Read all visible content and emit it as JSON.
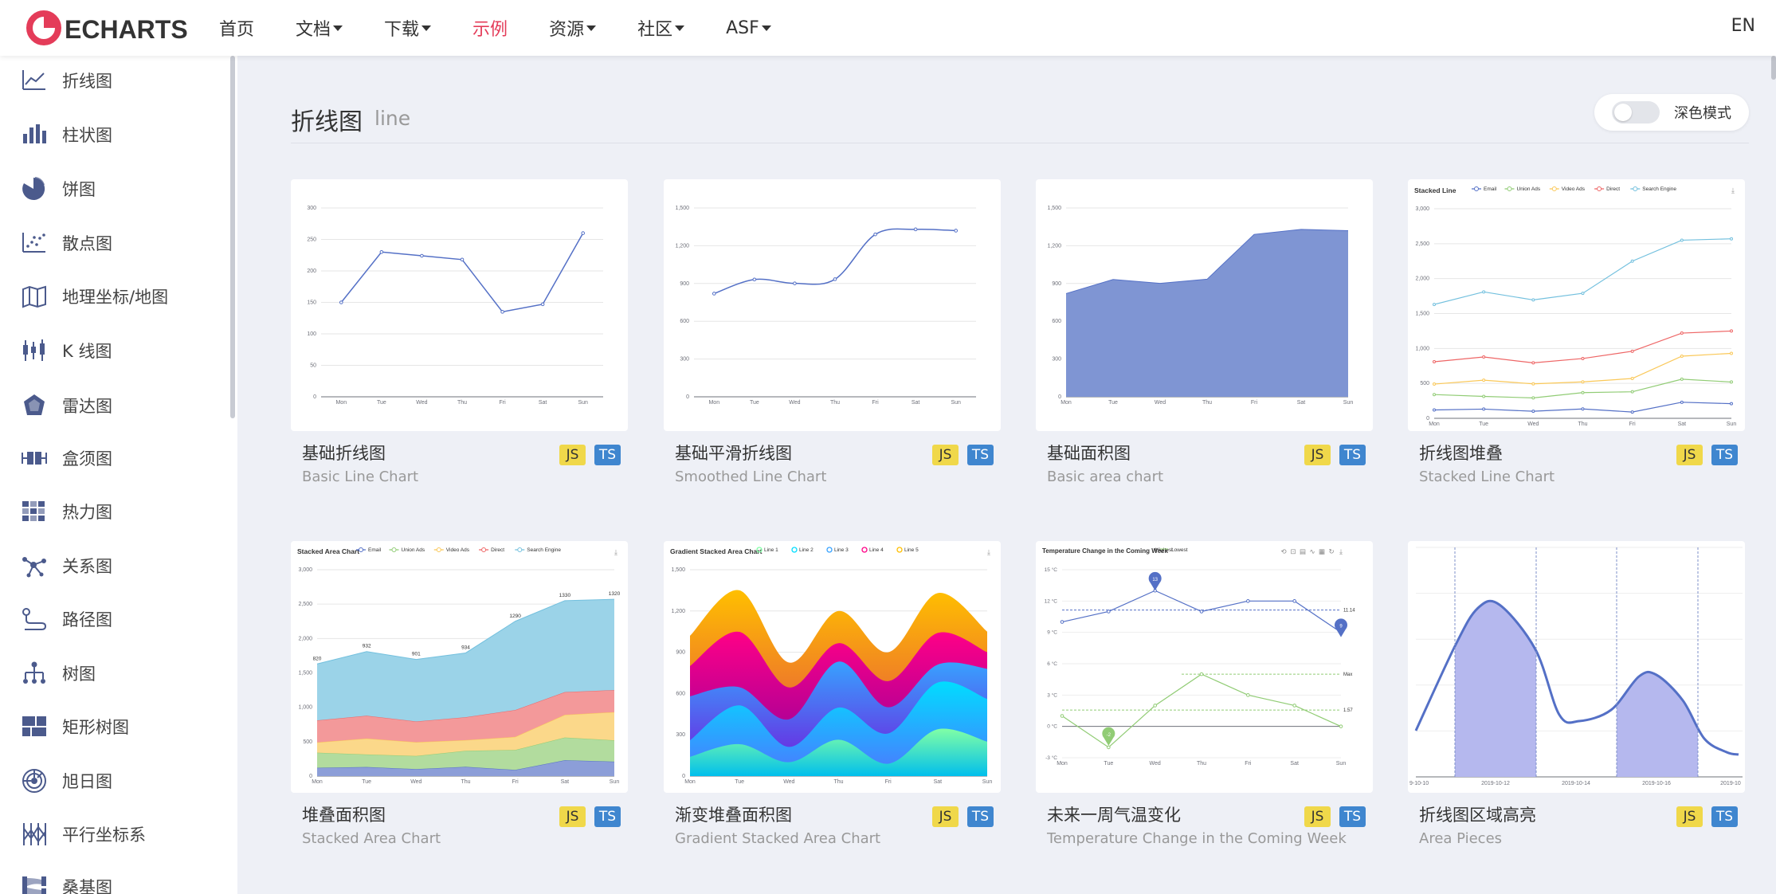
{
  "header": {
    "logo_text": "ECHARTS",
    "nav": [
      {
        "label": "首页",
        "dropdown": false,
        "active": false
      },
      {
        "label": "文档",
        "dropdown": true,
        "active": false
      },
      {
        "label": "下载",
        "dropdown": true,
        "active": false
      },
      {
        "label": "示例",
        "dropdown": false,
        "active": true
      },
      {
        "label": "资源",
        "dropdown": true,
        "active": false
      },
      {
        "label": "社区",
        "dropdown": true,
        "active": false
      },
      {
        "label": "ASF",
        "dropdown": true,
        "active": false
      }
    ],
    "lang": "EN",
    "accent_color": "#e43c59"
  },
  "sidebar": {
    "items": [
      {
        "label": "折线图",
        "icon": "line-chart-icon"
      },
      {
        "label": "柱状图",
        "icon": "bar-chart-icon"
      },
      {
        "label": "饼图",
        "icon": "pie-chart-icon"
      },
      {
        "label": "散点图",
        "icon": "scatter-chart-icon"
      },
      {
        "label": "地理坐标/地图",
        "icon": "map-icon"
      },
      {
        "label": "K 线图",
        "icon": "candlestick-icon"
      },
      {
        "label": "雷达图",
        "icon": "radar-icon"
      },
      {
        "label": "盒须图",
        "icon": "boxplot-icon"
      },
      {
        "label": "热力图",
        "icon": "heatmap-icon"
      },
      {
        "label": "关系图",
        "icon": "graph-icon"
      },
      {
        "label": "路径图",
        "icon": "lines-icon"
      },
      {
        "label": "树图",
        "icon": "tree-icon"
      },
      {
        "label": "矩形树图",
        "icon": "treemap-icon"
      },
      {
        "label": "旭日图",
        "icon": "sunburst-icon"
      },
      {
        "label": "平行坐标系",
        "icon": "parallel-icon"
      },
      {
        "label": "桑基图",
        "icon": "sankey-icon"
      }
    ]
  },
  "main": {
    "title": "折线图",
    "subtitle": "line",
    "dark_mode_label": "深色模式",
    "badge_js": "JS",
    "badge_ts": "TS",
    "cards": [
      {
        "title": "基础折线图",
        "subtitle": "Basic Line Chart"
      },
      {
        "title": "基础平滑折线图",
        "subtitle": "Smoothed Line Chart"
      },
      {
        "title": "基础面积图",
        "subtitle": "Basic area chart"
      },
      {
        "title": "折线图堆叠",
        "subtitle": "Stacked Line Chart"
      },
      {
        "title": "堆叠面积图",
        "subtitle": "Stacked Area Chart"
      },
      {
        "title": "渐变堆叠面积图",
        "subtitle": "Gradient Stacked Area Chart"
      },
      {
        "title": "未来一周气温变化",
        "subtitle": "Temperature Change in the Coming Week"
      },
      {
        "title": "折线图区域高亮",
        "subtitle": "Area Pieces"
      }
    ]
  },
  "thumbs": {
    "days": [
      "Mon",
      "Tue",
      "Wed",
      "Thu",
      "Fri",
      "Sat",
      "Sun"
    ],
    "basic_line": {
      "yticks": [
        "0",
        "50",
        "100",
        "150",
        "200",
        "250",
        "300"
      ],
      "values": [
        150,
        230,
        224,
        218,
        135,
        147,
        260
      ]
    },
    "smooth_line": {
      "yticks": [
        "0",
        "300",
        "600",
        "900",
        "1,200",
        "1,500"
      ],
      "values": [
        820,
        932,
        901,
        934,
        1290,
        1330,
        1320
      ]
    },
    "basic_area": {
      "yticks": [
        "0",
        "300",
        "600",
        "900",
        "1,200",
        "1,500"
      ],
      "values": [
        820,
        932,
        901,
        934,
        1290,
        1330,
        1320
      ]
    },
    "stacked_line": {
      "title": "Stacked Line",
      "legend": [
        "Email",
        "Union Ads",
        "Video Ads",
        "Direct",
        "Search Engine"
      ],
      "colors": [
        "#5470c6",
        "#91cc75",
        "#fac858",
        "#ee6666",
        "#73c0de"
      ],
      "yticks": [
        "0",
        "500",
        "1,000",
        "1,500",
        "2,000",
        "2,500",
        "3,000"
      ],
      "series": [
        [
          120,
          132,
          101,
          134,
          90,
          230,
          210
        ],
        [
          220,
          182,
          191,
          234,
          290,
          330,
          310
        ],
        [
          150,
          232,
          201,
          154,
          190,
          330,
          410
        ],
        [
          320,
          332,
          301,
          334,
          390,
          330,
          320
        ],
        [
          820,
          932,
          901,
          934,
          1290,
          1330,
          1320
        ]
      ]
    },
    "stacked_area": {
      "title": "Stacked Area Chart",
      "legend": [
        "Email",
        "Union Ads",
        "Video Ads",
        "Direct",
        "Search Engine"
      ],
      "colors": [
        "#5470c6",
        "#91cc75",
        "#fac858",
        "#ee6666",
        "#73c0de"
      ],
      "yticks": [
        "0",
        "500",
        "1,000",
        "1,500",
        "2,000",
        "2,500",
        "3,000"
      ],
      "top_labels": [
        "820",
        "932",
        "901",
        "934",
        "1290",
        "1330",
        "1320"
      ]
    },
    "gradient_area": {
      "title": "Gradient Stacked Area Chart",
      "legend": [
        "Line 1",
        "Line 2",
        "Line 3",
        "Line 4",
        "Line 5"
      ],
      "yticks": [
        "0",
        "300",
        "600",
        "900",
        "1,200",
        "1,500"
      ]
    },
    "temperature": {
      "title": "Temperature Change in the Coming Week",
      "legend": [
        "Highest",
        "Lowest"
      ],
      "yticks": [
        "-3 °C",
        "0 °C",
        "3 °C",
        "6 °C",
        "9 °C",
        "12 °C",
        "15 °C"
      ],
      "highest": [
        10,
        11,
        13,
        11,
        12,
        12,
        9
      ],
      "lowest": [
        1,
        -2,
        2,
        5,
        3,
        2,
        0
      ],
      "max_label": "13",
      "min_label": "9",
      "low_min_label": "-2",
      "avg_high_label": "11.14",
      "max_line_label": "Max",
      "avg_low_label": "1.57"
    },
    "area_pieces": {
      "xlabels": [
        "9-10-10",
        "2019-10-12",
        "2019-10-14",
        "2019-10-16",
        "2019-10"
      ]
    }
  }
}
